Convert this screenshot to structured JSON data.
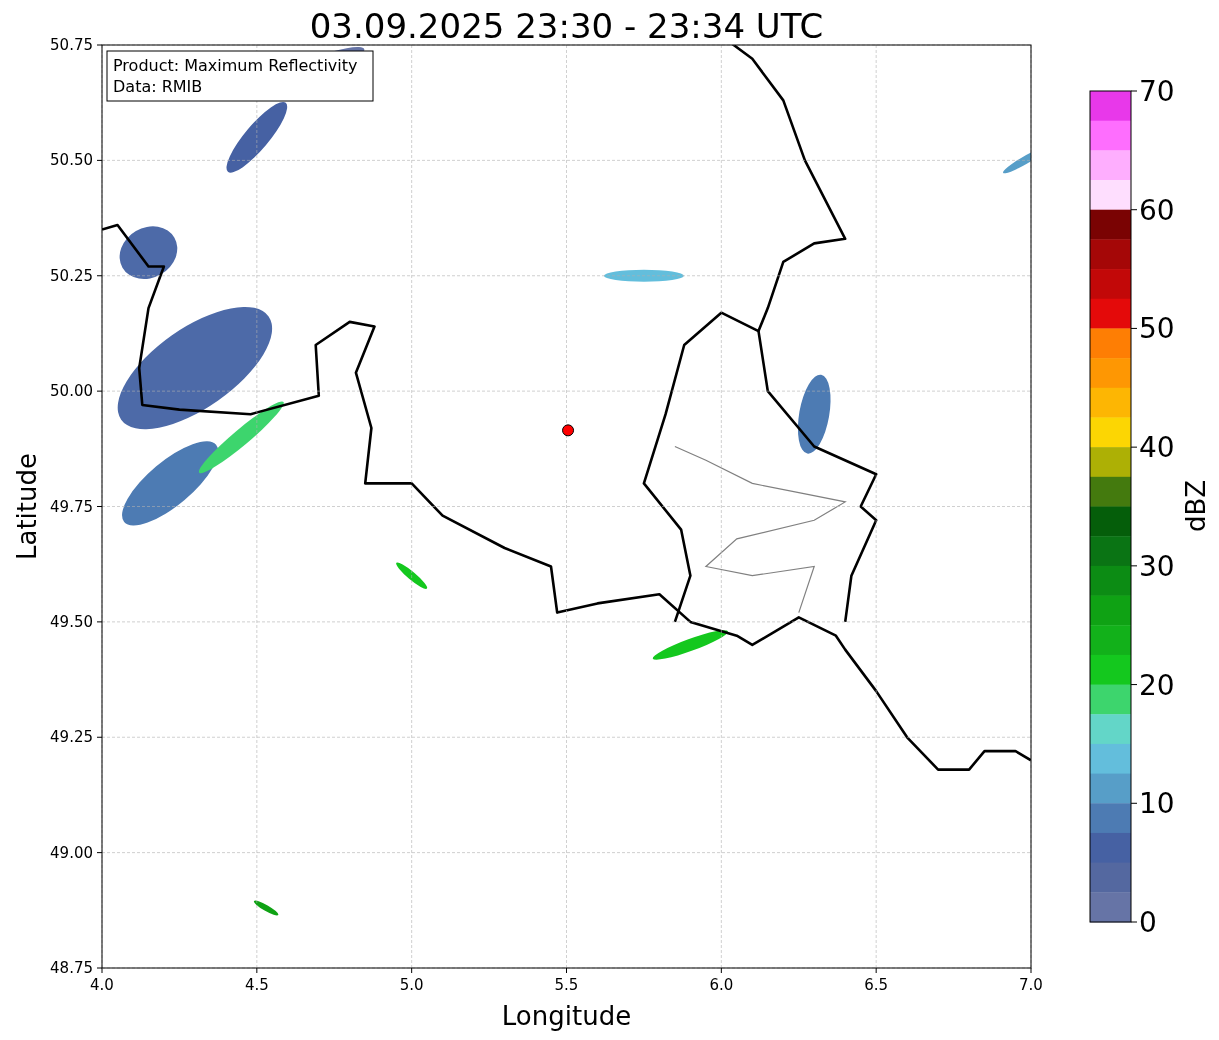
{
  "figure": {
    "info_box": [
      "Product: Maximum Reflectivity",
      "Data: RMIB"
    ],
    "chart_data": {
      "type": "scatter",
      "grid": true,
      "title": "03.09.2025 23:30 - 23:34 UTC",
      "xlabel": "Longitude",
      "ylabel": "Latitude",
      "xlim": [
        4,
        7
      ],
      "ylim": [
        48.75,
        50.75
      ],
      "xticks": [
        {
          "value": 4,
          "label": "4.0"
        },
        {
          "value": 4.5,
          "label": "4.5"
        },
        {
          "value": 5,
          "label": "5.0"
        },
        {
          "value": 5.5,
          "label": "5.5"
        },
        {
          "value": 6,
          "label": "6.0"
        },
        {
          "value": 6.5,
          "label": "6.5"
        },
        {
          "value": 7,
          "label": "7.0"
        }
      ],
      "yticks": [
        {
          "value": 48.75,
          "label": "48.75"
        },
        {
          "value": 49,
          "label": "49.00"
        },
        {
          "value": 49.25,
          "label": "49.25"
        },
        {
          "value": 49.5,
          "label": "49.50"
        },
        {
          "value": 49.75,
          "label": "49.75"
        },
        {
          "value": 50,
          "label": "50.00"
        },
        {
          "value": 50.25,
          "label": "50.25"
        },
        {
          "value": 50.5,
          "label": "50.50"
        },
        {
          "value": 50.75,
          "label": "50.75"
        }
      ],
      "x": [
        5.505
      ],
      "series": [
        {
          "color": "#ff0000",
          "values": [
            49.915
          ]
        }
      ]
    },
    "colorbar": {
      "label": "dBZ",
      "ticks": [
        "70",
        "60",
        "50",
        "40",
        "30",
        "20",
        "10",
        "0"
      ],
      "bins": [
        {
          "color": "#e838ea"
        },
        {
          "color": "#fe6efe"
        },
        {
          "color": "#feaefe"
        },
        {
          "color": "#fedefe"
        },
        {
          "color": "#7a0303"
        },
        {
          "color": "#a50707"
        },
        {
          "color": "#c20808"
        },
        {
          "color": "#e40a0a"
        },
        {
          "color": "#fe7e04"
        },
        {
          "color": "#fe9703"
        },
        {
          "color": "#fdb603"
        },
        {
          "color": "#fcd603"
        },
        {
          "color": "#adb005"
        },
        {
          "color": "#447a0e"
        },
        {
          "color": "#055e0a"
        },
        {
          "color": "#0a7414"
        },
        {
          "color": "#0c8c14"
        },
        {
          "color": "#0fa214"
        },
        {
          "color": "#12b11a"
        },
        {
          "color": "#14c81e"
        },
        {
          "color": "#3dd56d"
        },
        {
          "color": "#63d6c8"
        },
        {
          "color": "#63bedc"
        },
        {
          "color": "#579ec8"
        },
        {
          "color": "#4d7bb3"
        },
        {
          "color": "#4661a3"
        },
        {
          "color": "#5468a0"
        },
        {
          "color": "#6674a6"
        }
      ]
    }
  }
}
